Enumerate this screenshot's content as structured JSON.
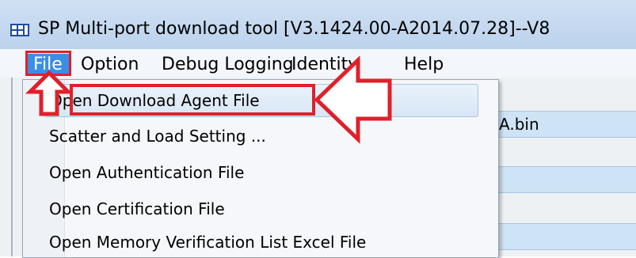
{
  "window": {
    "title": "SP Multi-port download tool [V3.1424.00-A2014.07.28]--V8",
    "app_icon": "app-icon"
  },
  "menubar": {
    "items": [
      {
        "label": "File",
        "active": true
      },
      {
        "label": "Option"
      },
      {
        "label": "Debug Logging"
      },
      {
        "label": "Identity"
      },
      {
        "label": "Help"
      }
    ]
  },
  "file_menu": {
    "items": [
      {
        "label": "Open Download Agent File",
        "highlighted": true
      },
      {
        "label": "Scatter and Load Setting ..."
      },
      {
        "label": "Open Authentication File"
      },
      {
        "label": "Open Certification File"
      },
      {
        "label": "Open Memory Verification List Excel File"
      }
    ]
  },
  "background_fields": {
    "first_value": "A.bin"
  },
  "annotations": {
    "color": "#e0202a",
    "arrows": [
      "up-arrow-icon",
      "left-arrow-icon"
    ]
  }
}
